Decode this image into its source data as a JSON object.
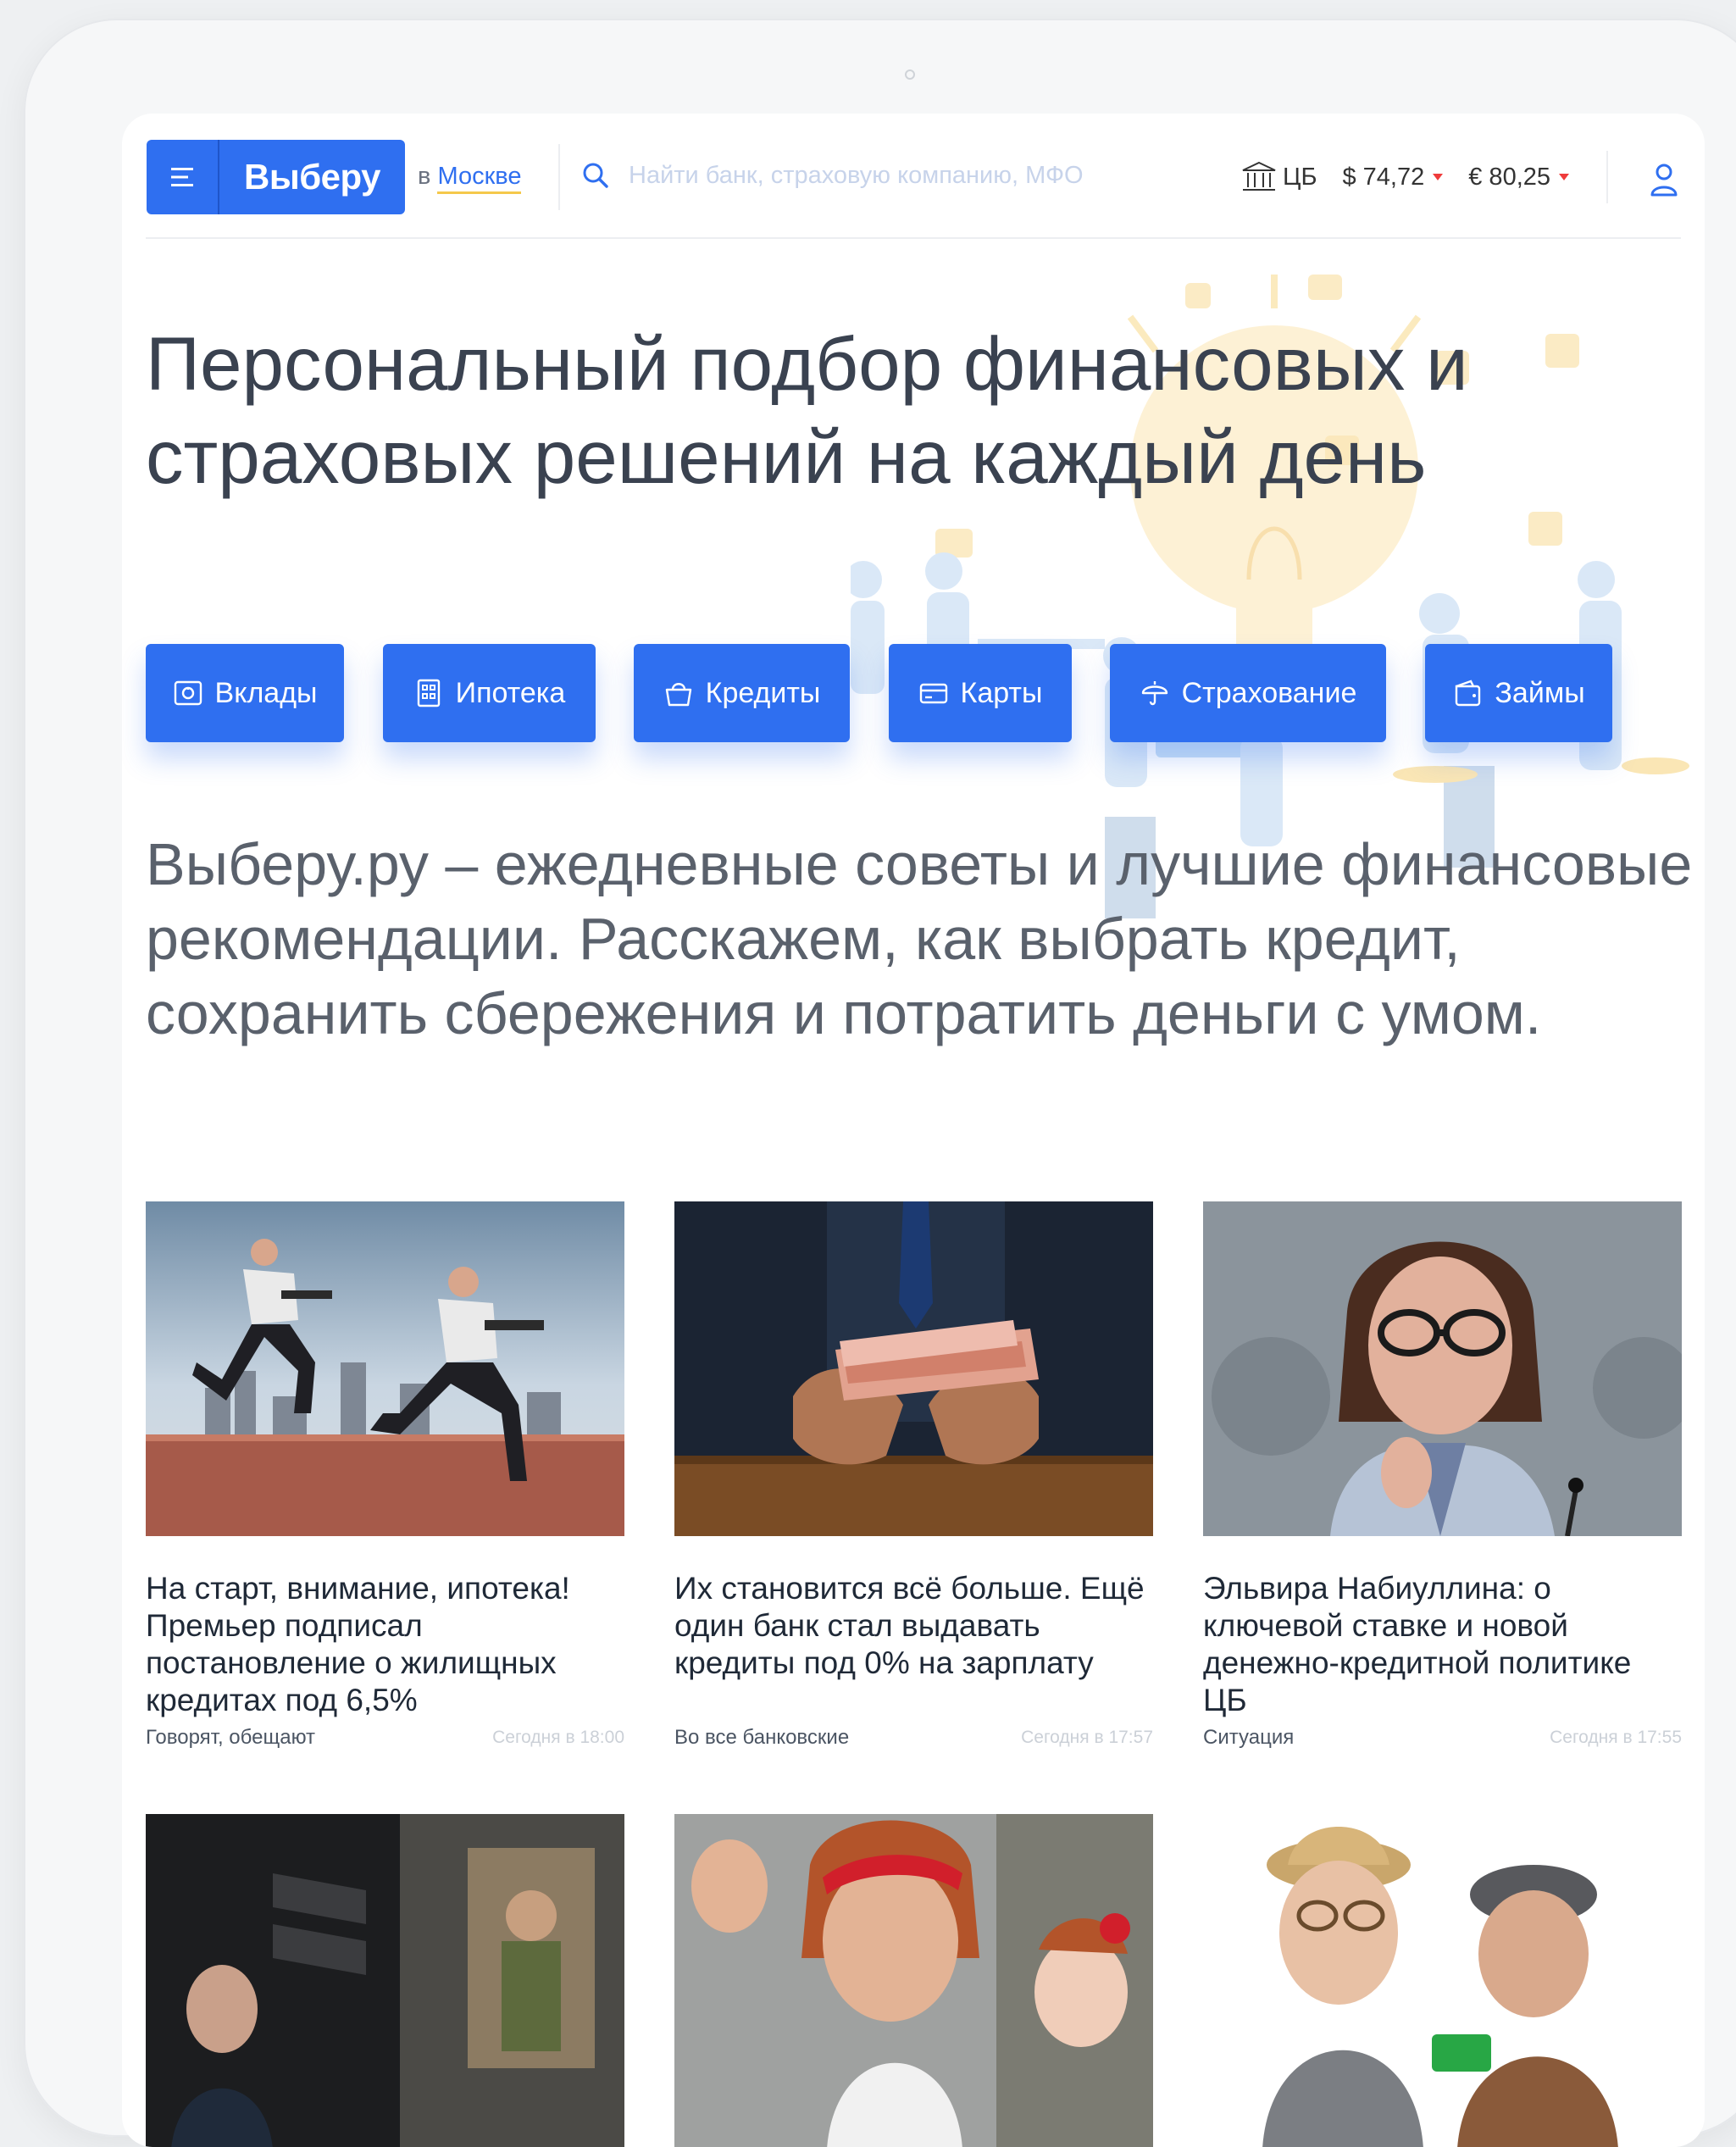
{
  "header": {
    "brand": "Выберу",
    "city_prefix": "в",
    "city": "Москве",
    "search_placeholder": "Найти банк, страховую компанию, МФО",
    "cb_label": "ЦБ",
    "usd": "$ 74,72",
    "eur": "€ 80,25"
  },
  "hero": {
    "title": "Персональный подбор финансовых и страховых решений на каждый день"
  },
  "categories": [
    {
      "label": "Вклады",
      "icon": "deposit-icon"
    },
    {
      "label": "Ипотека",
      "icon": "mortgage-icon"
    },
    {
      "label": "Кредиты",
      "icon": "credit-icon"
    },
    {
      "label": "Карты",
      "icon": "card-icon"
    },
    {
      "label": "Страхование",
      "icon": "insurance-icon"
    },
    {
      "label": "Займы",
      "icon": "loan-icon"
    }
  ],
  "tagline": "Выберу.ру – ежедневные советы и лучшие финансовые рекомендации. Расскажем, как выбрать кредит, сохранить сбережения и потратить деньги с умом.",
  "news": [
    {
      "title": "На старт, внимание, ипотека! Премьер подписал постановление о жилищных кредитах под 6,5%",
      "tag": "Говорят, обещают",
      "time": "Сегодня в 18:00"
    },
    {
      "title": "Их становится всё больше. Ещё один банк стал выдавать кредиты под 0% на зарплату",
      "tag": "Во все банковские",
      "time": "Сегодня в 17:57"
    },
    {
      "title": "Эльвира Набиуллина: о ключевой ставке и новой денежно-кредитной политике ЦБ",
      "tag": "Ситуация",
      "time": "Сегодня в 17:55"
    }
  ],
  "colors": {
    "accent": "#2f6ff0",
    "underline": "#f5c84b",
    "rate_down": "#ef3b3b"
  }
}
